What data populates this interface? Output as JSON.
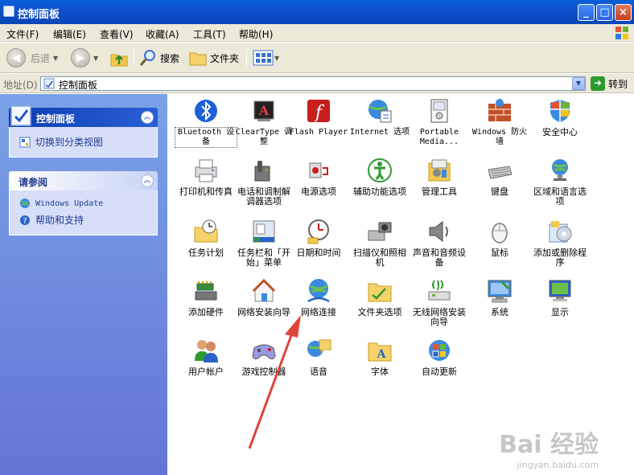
{
  "window": {
    "title": "控制面板",
    "min": "_",
    "max": "□",
    "close": "×"
  },
  "menu": [
    "文件(F)",
    "编辑(E)",
    "查看(V)",
    "收藏(A)",
    "工具(T)",
    "帮助(H)"
  ],
  "toolbar": {
    "back": "后退",
    "search": "搜索",
    "folders": "文件夹"
  },
  "address": {
    "label": "地址(D)",
    "value": "控制面板",
    "go": "转到"
  },
  "sidebar": {
    "panel1": {
      "title": "控制面板",
      "link": "切换到分类视图"
    },
    "panel2": {
      "title": "请参阅",
      "links": [
        "Windows Update",
        "帮助和支持"
      ]
    }
  },
  "items": [
    {
      "label": "Bluetooth 设备",
      "icon": "bluetooth-icon",
      "mono": true,
      "selected": true
    },
    {
      "label": "ClearType 调整",
      "icon": "cleartype-icon",
      "mono": true
    },
    {
      "label": "Flash Player",
      "icon": "flash-icon",
      "mono": true
    },
    {
      "label": "Internet 选项",
      "icon": "internet-options-icon",
      "mono": true
    },
    {
      "label": "Portable Media...",
      "icon": "portable-media-icon",
      "mono": true
    },
    {
      "label": "Windows 防火墙",
      "icon": "firewall-icon",
      "mono": true
    },
    {
      "label": "安全中心",
      "icon": "security-center-icon"
    },
    {
      "label": "打印机和传真",
      "icon": "printer-icon"
    },
    {
      "label": "电话和调制解调器选项",
      "icon": "phone-modem-icon"
    },
    {
      "label": "电源选项",
      "icon": "power-icon"
    },
    {
      "label": "辅助功能选项",
      "icon": "accessibility-icon"
    },
    {
      "label": "管理工具",
      "icon": "admin-tools-icon"
    },
    {
      "label": "键盘",
      "icon": "keyboard-icon"
    },
    {
      "label": "区域和语言选项",
      "icon": "region-language-icon"
    },
    {
      "label": "任务计划",
      "icon": "scheduled-tasks-icon"
    },
    {
      "label": "任务栏和「开始」菜单",
      "icon": "taskbar-icon"
    },
    {
      "label": "日期和时间",
      "icon": "clock-icon"
    },
    {
      "label": "扫描仪和照相机",
      "icon": "scanner-icon"
    },
    {
      "label": "声音和音频设备",
      "icon": "speaker-icon"
    },
    {
      "label": "鼠标",
      "icon": "mouse-icon"
    },
    {
      "label": "添加或删除程序",
      "icon": "add-remove-programs-icon"
    },
    {
      "label": "添加硬件",
      "icon": "add-hardware-icon"
    },
    {
      "label": "网络安装向导",
      "icon": "network-setup-icon"
    },
    {
      "label": "网络连接",
      "icon": "network-connections-icon"
    },
    {
      "label": "文件夹选项",
      "icon": "folder-options-icon"
    },
    {
      "label": "无线网络安装向导",
      "icon": "wireless-setup-icon"
    },
    {
      "label": "系统",
      "icon": "system-icon"
    },
    {
      "label": "显示",
      "icon": "display-icon"
    },
    {
      "label": "用户帐户",
      "icon": "user-accounts-icon"
    },
    {
      "label": "游戏控制器",
      "icon": "game-controller-icon"
    },
    {
      "label": "语音",
      "icon": "speech-icon"
    },
    {
      "label": "字体",
      "icon": "fonts-icon"
    },
    {
      "label": "自动更新",
      "icon": "automatic-updates-icon"
    }
  ],
  "watermark": {
    "brand": "Bai 经验",
    "url": "jingyan.baidu.com"
  },
  "colors": {
    "title_bar": "#0a5fd8",
    "sidebar": "#6f8fe0",
    "arrow": "#e0433c"
  }
}
